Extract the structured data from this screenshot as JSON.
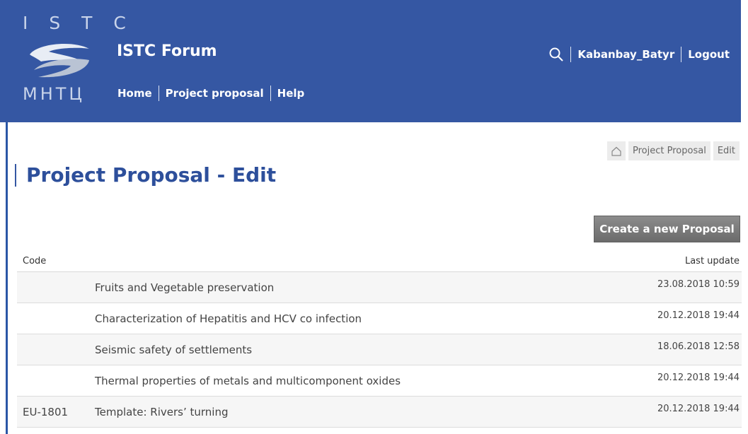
{
  "brand": {
    "logo_top": "I S T C",
    "logo_bottom": "МНТЦ",
    "site_title": "ISTC Forum",
    "color_header": "#3557a3"
  },
  "nav": {
    "home": "Home",
    "project_proposal": "Project proposal",
    "help": "Help"
  },
  "user": {
    "search_icon": "search-icon",
    "username": "Kabanbay_Batyr",
    "logout": "Logout"
  },
  "breadcrumb": {
    "home_icon": "home-icon",
    "item1": "Project Proposal",
    "item2": "Edit"
  },
  "page": {
    "title": "Project Proposal - Edit",
    "create_button": "Create a new Proposal"
  },
  "table": {
    "col_code": "Code",
    "col_last_update": "Last update",
    "rows": [
      {
        "code": "",
        "title": "Fruits and Vegetable preservation",
        "updated": "23.08.2018 10:59"
      },
      {
        "code": "",
        "title": "Characterization of Hepatitis and HCV co infection",
        "updated": "20.12.2018 19:44"
      },
      {
        "code": "",
        "title": "Seismic safety of settlements",
        "updated": "18.06.2018 12:58"
      },
      {
        "code": "",
        "title": "Thermal properties of metals and multicomponent oxides",
        "updated": "20.12.2018 19:44"
      },
      {
        "code": "EU-1801",
        "title": "Template: Rivers’ turning",
        "updated": "20.12.2018 19:44"
      }
    ]
  }
}
